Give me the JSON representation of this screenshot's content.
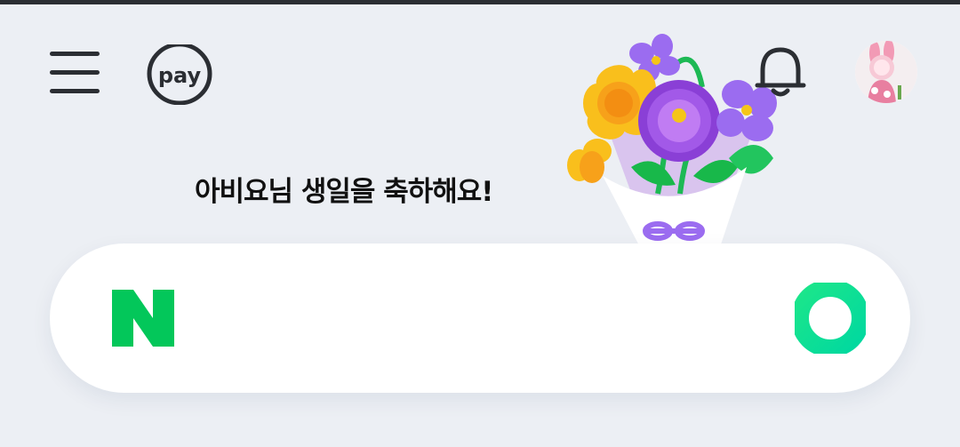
{
  "header": {
    "pay_label": "pay"
  },
  "greeting": {
    "text": "아비요님 생일을 축하해요!"
  },
  "search": {
    "logo_letter": "N",
    "value": "",
    "placeholder": ""
  },
  "colors": {
    "background": "#eceff4",
    "brand_green": "#03c75a",
    "icon_dark": "#2b2e33"
  },
  "icons": {
    "menu": "menu-icon",
    "pay": "pay-icon",
    "notification": "bell-icon",
    "greendot": "green-dot-icon"
  }
}
